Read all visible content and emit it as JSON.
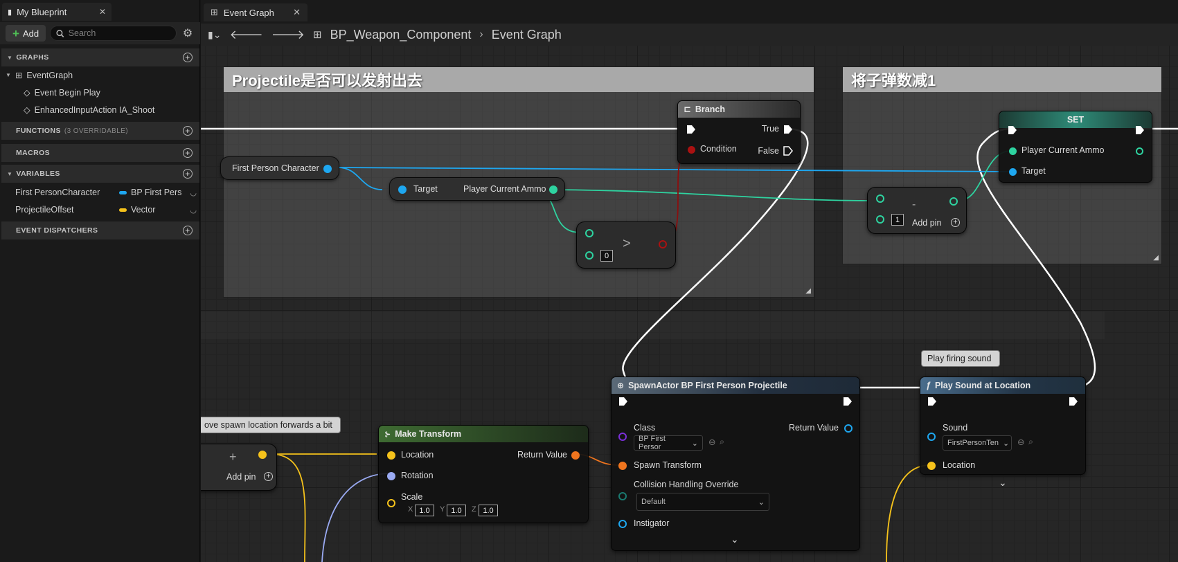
{
  "colors": {
    "exec": "#ffffff",
    "object": "#1ea7f0",
    "integer": "#2ed3a0",
    "boolean": "#8a0f0f",
    "struct_vector": "#f5c21b",
    "struct_transform": "#f0751e",
    "rotator": "#9aaaf2",
    "class": "#7b2fd8"
  },
  "left_panel": {
    "tab_title": "My Blueprint",
    "add_label": "Add",
    "search_placeholder": "Search",
    "sections": {
      "graphs": "GRAPHS",
      "functions": "FUNCTIONS",
      "functions_sub": "(3 OVERRIDABLE)",
      "macros": "MACROS",
      "variables": "VARIABLES",
      "dispatchers": "EVENT DISPATCHERS"
    },
    "graph_tree": {
      "root": "EventGraph",
      "events": [
        "Event Begin Play",
        "EnhancedInputAction IA_Shoot"
      ]
    },
    "variables": [
      {
        "name": "First PersonCharacter",
        "type": "BP First Pers",
        "color": "#1ea7f0"
      },
      {
        "name": "ProjectileOffset",
        "type": "Vector",
        "color": "#f5c21b"
      }
    ]
  },
  "graph": {
    "tab_title": "Event Graph",
    "breadcrumb": [
      "BP_Weapon_Component",
      "Event Graph"
    ],
    "comments": {
      "projectile": "Projectile是否可以发射出去",
      "ammo": "将子弹数减1",
      "spawn_note": "ove spawn location forwards a bit",
      "sound_note": "Play firing sound"
    },
    "nodes": {
      "first_person_char": "First Person Character",
      "get_ammo_target": "Target",
      "get_ammo_output": "Player Current Ammo",
      "greater_symbol": ">",
      "greater_value": "0",
      "branch_title": "Branch",
      "branch_condition": "Condition",
      "branch_true": "True",
      "branch_false": "False",
      "subtract_symbol": "-",
      "subtract_value": "1",
      "subtract_add_pin": "Add pin",
      "set_title": "SET",
      "set_ammo": "Player Current Ammo",
      "set_target": "Target",
      "add_add_pin": "Add pin",
      "make_transform_title": "Make Transform",
      "mt_location": "Location",
      "mt_rotation": "Rotation",
      "mt_scale": "Scale",
      "mt_return": "Return Value",
      "mt_x": "1.0",
      "mt_y": "1.0",
      "mt_z": "1.0",
      "spawn_title": "SpawnActor BP First Person Projectile",
      "spawn_class": "Class",
      "spawn_class_value": "BP First Persor",
      "spawn_return": "Return Value",
      "spawn_transform": "Spawn Transform",
      "spawn_collision": "Collision Handling Override",
      "spawn_collision_value": "Default",
      "spawn_instigator": "Instigator",
      "sound_title": "Play Sound at Location",
      "sound_sound": "Sound",
      "sound_value": "FirstPersonTen",
      "sound_location": "Location"
    }
  }
}
